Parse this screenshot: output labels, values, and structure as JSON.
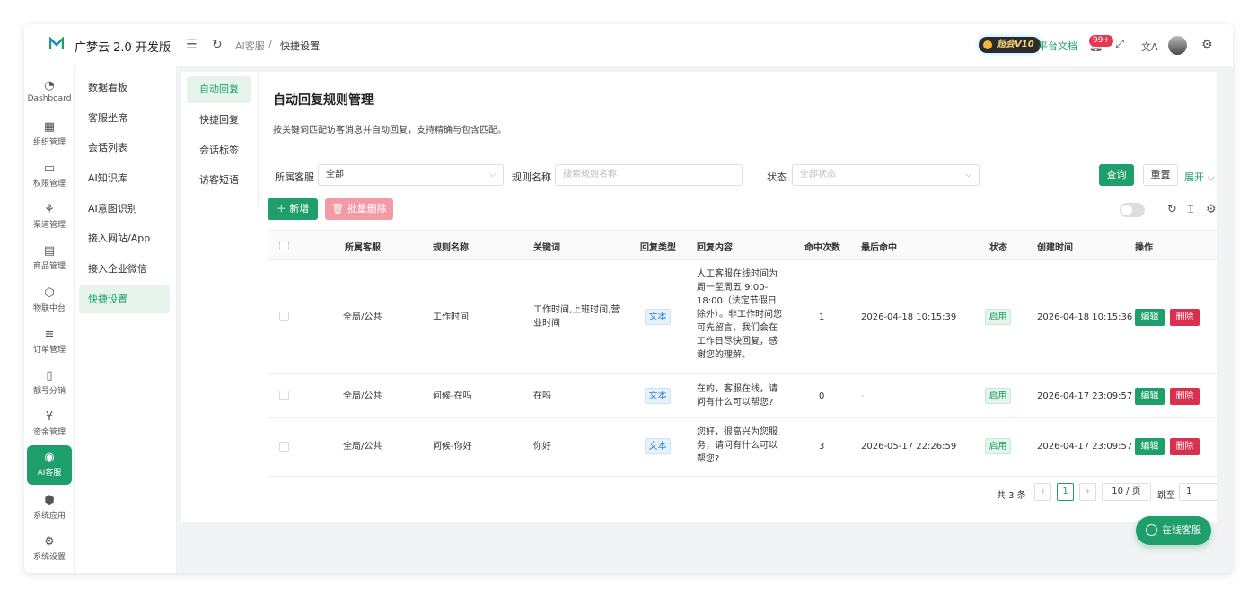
{
  "header": {
    "brand": "广梦云 2.0 开发版",
    "breadcrumb": [
      "AI客服",
      "快捷设置"
    ],
    "vip_label": "超会V10",
    "doc_link": "平台文档",
    "notification_badge": "99+"
  },
  "rail": {
    "items": [
      {
        "label": "Dashboard",
        "icon": "dashboard-icon"
      },
      {
        "label": "组织管理",
        "icon": "grid-icon"
      },
      {
        "label": "权限管理",
        "icon": "monitor-icon"
      },
      {
        "label": "渠道管理",
        "icon": "share-icon"
      },
      {
        "label": "商品管理",
        "icon": "store-icon"
      },
      {
        "label": "物联中台",
        "icon": "cube-icon"
      },
      {
        "label": "订单管理",
        "icon": "list-icon"
      },
      {
        "label": "靓号分销",
        "icon": "phone-icon"
      },
      {
        "label": "资金管理",
        "icon": "yen-icon"
      },
      {
        "label": "AI客服",
        "icon": "ai-icon"
      },
      {
        "label": "系统应用",
        "icon": "box-icon"
      },
      {
        "label": "系统设置",
        "icon": "gear-icon"
      }
    ],
    "active_index": 9
  },
  "submenu": {
    "items": [
      "数据看板",
      "客服坐席",
      "会话列表",
      "AI知识库",
      "AI意图识别",
      "接入网站/App",
      "接入企业微信",
      "快捷设置"
    ],
    "active_index": 7
  },
  "inner_nav": {
    "items": [
      "自动回复",
      "快捷回复",
      "会话标签",
      "访客短语"
    ],
    "active_index": 0
  },
  "page": {
    "title": "自动回复规则管理",
    "description": "按关键词匹配访客消息并自动回复，支持精确与包含匹配。"
  },
  "filters": {
    "agent_label": "所属客服",
    "agent_value": "全部",
    "rule_label": "规则名称",
    "rule_placeholder": "搜索规则名称",
    "status_label": "状态",
    "status_placeholder": "全部状态",
    "query_button": "查询",
    "reset_button": "重置",
    "expand_button": "展开"
  },
  "toolbar": {
    "add_button": "新增",
    "batch_delete_button": "批量删除"
  },
  "table": {
    "columns": [
      "所属客服",
      "规则名称",
      "关键词",
      "回复类型",
      "回复内容",
      "命中次数",
      "最后命中",
      "状态",
      "创建时间",
      "操作"
    ],
    "rows": [
      {
        "agent": "全局/公共",
        "name": "工作时间",
        "keywords": "工作时间,上班时间,营业时间",
        "reply_type": "文本",
        "content": "人工客服在线时间为周一至周五 9:00-18:00（法定节假日除外）。非工作时间您可先留言，我们会在工作日尽快回复，感谢您的理解。",
        "hits": "1",
        "last_hit": "2026-04-18 10:15:39",
        "status": "启用",
        "created": "2026-04-18 10:15:36",
        "edit": "编辑",
        "delete": "删除"
      },
      {
        "agent": "全局/公共",
        "name": "问候-在吗",
        "keywords": "在吗",
        "reply_type": "文本",
        "content": "在的，客服在线，请问有什么可以帮您?",
        "hits": "0",
        "last_hit": "-",
        "status": "启用",
        "created": "2026-04-17 23:09:57",
        "edit": "编辑",
        "delete": "删除"
      },
      {
        "agent": "全局/公共",
        "name": "问候-你好",
        "keywords": "你好",
        "reply_type": "文本",
        "content": "您好，很高兴为您服务，请问有什么可以帮您?",
        "hits": "3",
        "last_hit": "2026-05-17 22:26:59",
        "status": "启用",
        "created": "2026-04-17 23:09:57",
        "edit": "编辑",
        "delete": "删除"
      }
    ]
  },
  "pagination": {
    "total": "共 3 条",
    "current_page": "1",
    "page_size": "10 / 页",
    "jump_label": "跳至",
    "jump_value": "1"
  },
  "chat_button": "在线客服",
  "colors": {
    "primary": "#1e9e6a",
    "danger": "#d9304f",
    "info": "#3a86c8"
  }
}
